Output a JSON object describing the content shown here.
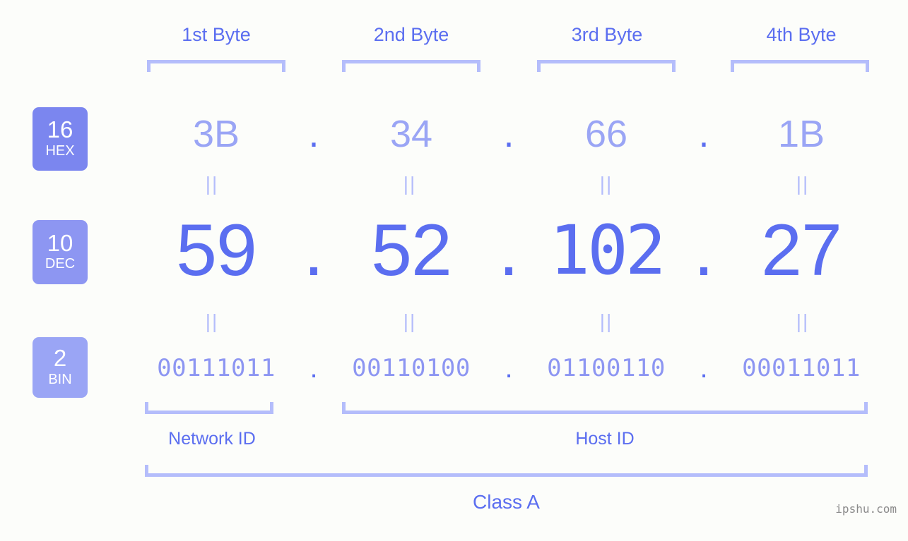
{
  "background_color": "#fcfdfa",
  "accent_color": "#5b6ef0",
  "bracket_color": "#b4bdfb",
  "headers": {
    "byte1": "1st Byte",
    "byte2": "2nd Byte",
    "byte3": "3rd Byte",
    "byte4": "4th Byte"
  },
  "bases": [
    {
      "number": "16",
      "name": "HEX",
      "color": "#7b86ef"
    },
    {
      "number": "10",
      "name": "DEC",
      "color": "#8d96f2"
    },
    {
      "number": "2",
      "name": "BIN",
      "color": "#9aa5f5"
    }
  ],
  "rows": {
    "hex": {
      "label": "HEX",
      "octets": [
        "3B",
        "34",
        "66",
        "1B"
      ],
      "separator": "."
    },
    "dec": {
      "label": "DEC",
      "octets": [
        "59",
        "52",
        "102",
        "27"
      ],
      "separator": "."
    },
    "bin": {
      "label": "BIN",
      "octets": [
        "00111011",
        "00110100",
        "01100110",
        "00011011"
      ],
      "separator": "."
    }
  },
  "equals_symbol": "||",
  "equivalence": {
    "hex_to_dec": [
      "||",
      "||",
      "||",
      "||"
    ],
    "dec_to_bin": [
      "||",
      "||",
      "||",
      "||"
    ]
  },
  "segments": {
    "network_id": "Network ID",
    "host_id": "Host ID"
  },
  "class_label": "Class A",
  "watermark": "ipshu.com"
}
